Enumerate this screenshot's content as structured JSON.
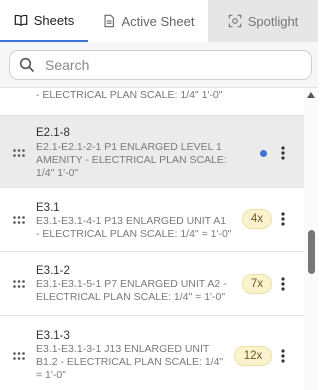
{
  "tabs": [
    {
      "label": "Sheets",
      "icon": "book-open-icon",
      "active": true
    },
    {
      "label": "Active Sheet",
      "icon": "document-icon",
      "active": false
    },
    {
      "label": "Spotlight",
      "icon": "spotlight-icon",
      "active": false
    }
  ],
  "search": {
    "placeholder": "Search",
    "value": ""
  },
  "partial_desc": "- ELECTRICAL PLAN SCALE: 1/4\" 1'-0\"",
  "rows": [
    {
      "title": "E2.1-8",
      "desc": "E2.1-E2.1-2-1 P1 ENLARGED LEVEL 1 AMENITY - ELECTRICAL PLAN SCALE: 1/4\" 1'-0\"",
      "selected": true,
      "indicator": "blue-dot"
    },
    {
      "title": "E3.1",
      "desc": "E3.1-E3.1-4-1 P13 ENLARGED UNIT A1 - ELECTRICAL PLAN SCALE: 1/4\" = 1'-0\"",
      "badge": "4x"
    },
    {
      "title": "E3.1-2",
      "desc": "E3.1-E3.1-5-1 P7 ENLARGED UNIT A2 - ELECTRICAL PLAN SCALE: 1/4\" = 1'-0\"",
      "badge": "7x"
    },
    {
      "title": "E3.1-3",
      "desc": "E3.1-E3.1-3-1 J13 ENLARGED UNIT B1.2 - ELECTRICAL PLAN SCALE: 1/4\" = 1'-0\"",
      "badge": "12x"
    }
  ],
  "colors": {
    "accent": "#3f73d6",
    "badge_bg": "#fbf3cf",
    "selected_row": "#ebebeb"
  }
}
